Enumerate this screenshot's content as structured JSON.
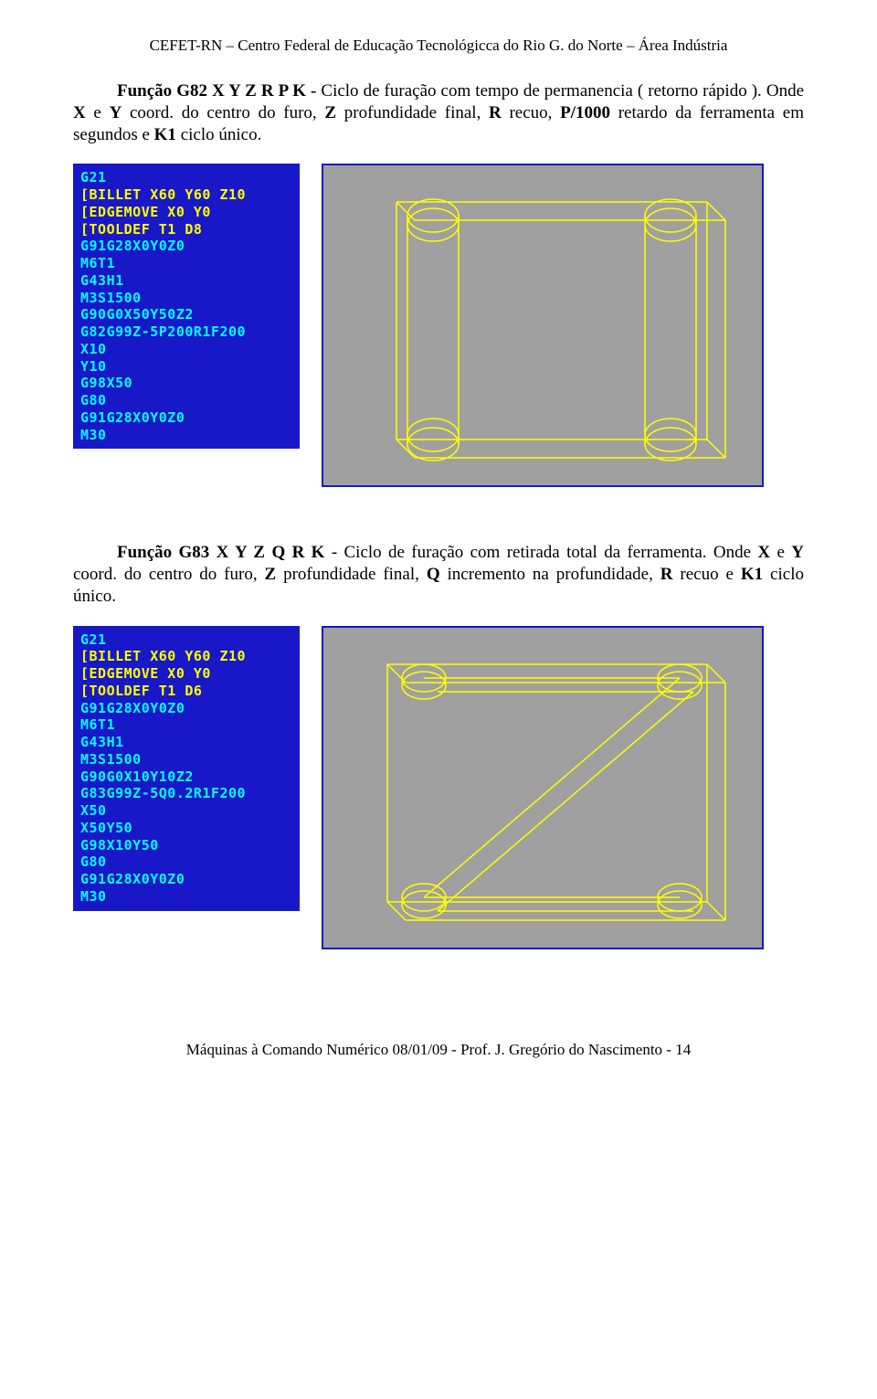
{
  "header": "CEFET-RN – Centro Federal de Educação Tecnológicca do Rio G. do Norte – Área Indústria",
  "para1": {
    "prefix": "Função G82 X Y Z R P K - ",
    "rest1": "Ciclo de furação com tempo de permanencia ( retorno rápido  ). Onde ",
    "b1": "X",
    "r1": " e ",
    "b2": "Y",
    "r2": " coord. do centro  do furo,  ",
    "b3": "Z",
    "r3": " profundidade  final, ",
    "b4": "R",
    "r4": " recuo, ",
    "b5": "P/1000",
    "r5": " retardo da ferramenta em  segundos e ",
    "b6": "K1",
    "r6": " ciclo único."
  },
  "code1": {
    "l1": "G21",
    "l2": "[BILLET X60 Y60 Z10",
    "l3": "[EDGEMOVE X0 Y0",
    "l4": "[TOOLDEF T1 D8",
    "l5": "G91G28X0Y0Z0",
    "l6": "M6T1",
    "l7": "G43H1",
    "l8": "M3S1500",
    "l9": "G90G0X50Y50Z2",
    "l10": "G82G99Z-5P200R1F200",
    "l11": "X10",
    "l12": "Y10",
    "l13": "G98X50",
    "l14": "G80",
    "l15": "G91G28X0Y0Z0",
    "l16": "M30"
  },
  "para2": {
    "prefix": "Função G83 X Y Z  Q R K ",
    "rest1": "- Ciclo  de  furação com retirada total da  ferramenta. Onde  ",
    "b1": "X",
    "r1": "  e  ",
    "b2": "Y",
    "r2": "  coord.    do  centro  do  furo,  ",
    "b3": "Z",
    "r3": "  profundidade  final,  ",
    "b4": "Q",
    "r4": "  incremento  na profundidade, ",
    "b5": "R",
    "r5": " recuo e  ",
    "b6": "K1",
    "r6": " ciclo único."
  },
  "code2": {
    "l1": "G21",
    "l2": "[BILLET X60 Y60 Z10",
    "l3": "[EDGEMOVE X0 Y0",
    "l4": "[TOOLDEF T1 D6",
    "l5": "G91G28X0Y0Z0",
    "l6": "M6T1",
    "l7": "G43H1",
    "l8": "M3S1500",
    "l9": "G90G0X10Y10Z2",
    "l10": "G83G99Z-5Q0.2R1F200",
    "l11": "X50",
    "l12": "X50Y50",
    "l13": "G98X10Y50",
    "l14": "G80",
    "l15": "G91G28X0Y0Z0",
    "l16": "M30"
  },
  "footer": "Máquinas à Comando Numérico 08/01/09 -  Prof. J. Gregório do  Nascimento - 14"
}
